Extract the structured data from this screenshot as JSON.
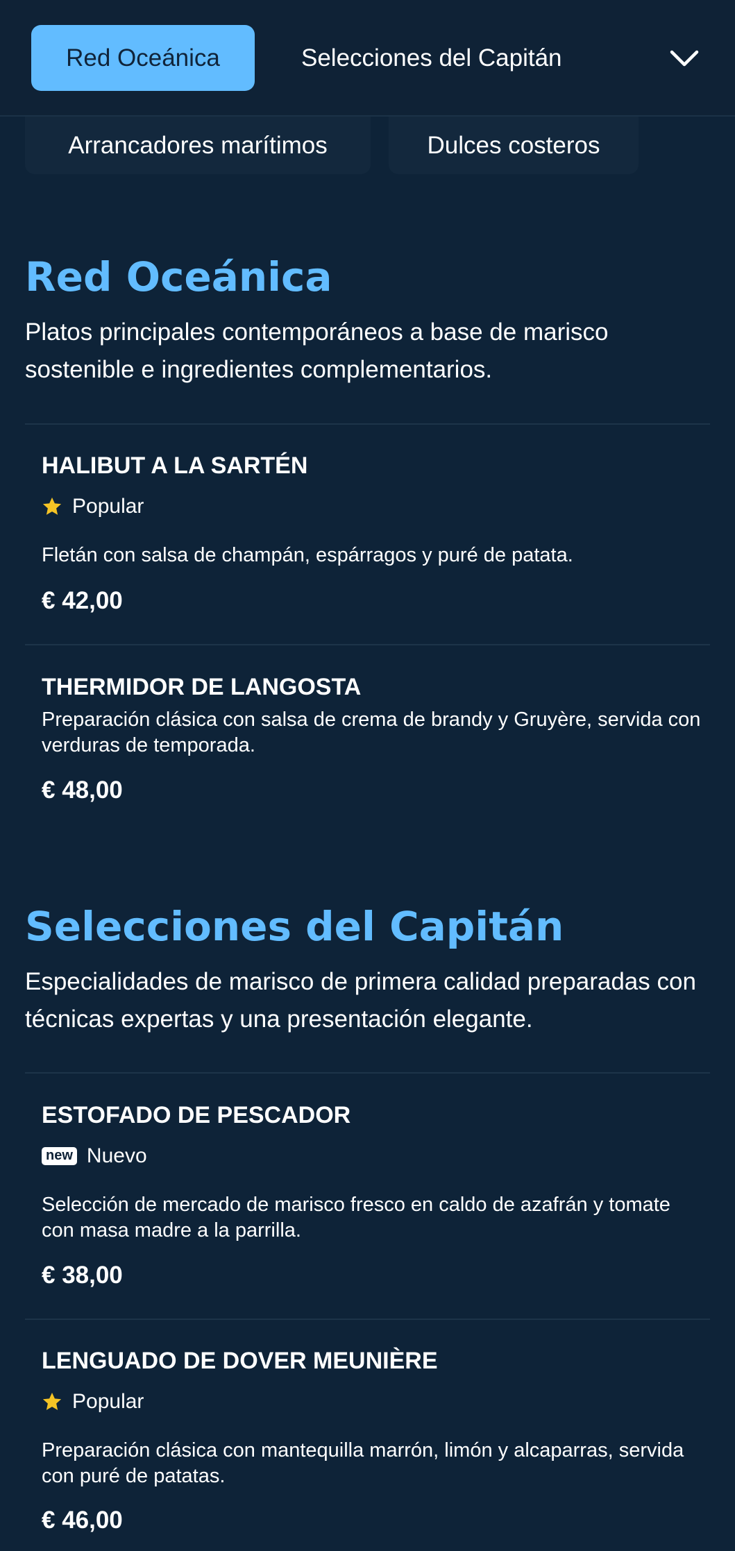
{
  "nav": {
    "tabs": [
      {
        "label": "Red Oceánica",
        "active": true
      },
      {
        "label": "Selecciones del Capitán",
        "active": false
      }
    ],
    "more_icon": "chevron-down-icon",
    "subtabs": [
      {
        "label": "Arrancadores marítimos"
      },
      {
        "label": "Dulces costeros"
      }
    ]
  },
  "colors": {
    "background": "#0e2338",
    "accent": "#62bcff",
    "star": "#f5c425"
  },
  "sections": [
    {
      "title": "Red Oceánica",
      "description": "Platos principales contemporáneos a base de marisco sostenible e ingredientes complementarios.",
      "items": [
        {
          "name": "HALIBUT A LA SARTÉN",
          "badge": {
            "icon": "star-icon",
            "label": "Popular"
          },
          "description": "Fletán con salsa de champán, espárragos y puré de patata.",
          "price": "€ 42,00"
        },
        {
          "name": "THERMIDOR DE LANGOSTA",
          "description": "Preparación clásica con salsa de crema de brandy y Gruyère, servida con verduras de temporada.",
          "price": "€ 48,00"
        }
      ]
    },
    {
      "title": "Selecciones del Capitán",
      "description": "Especialidades de marisco de primera calidad preparadas con técnicas expertas y una presentación elegante.",
      "items": [
        {
          "name": "ESTOFADO DE PESCADOR",
          "badge": {
            "icon": "new-icon",
            "tag": "new",
            "label": "Nuevo"
          },
          "description": "Selección de mercado de marisco fresco en caldo de azafrán y tomate con masa madre a la parrilla.",
          "price": "€ 38,00"
        },
        {
          "name": "LENGUADO DE DOVER MEUNIÈRE",
          "badge": {
            "icon": "star-icon",
            "label": "Popular"
          },
          "description": "Preparación clásica con mantequilla marrón, limón y alcaparras, servida con puré de patatas.",
          "price": "€ 46,00"
        }
      ]
    }
  ]
}
